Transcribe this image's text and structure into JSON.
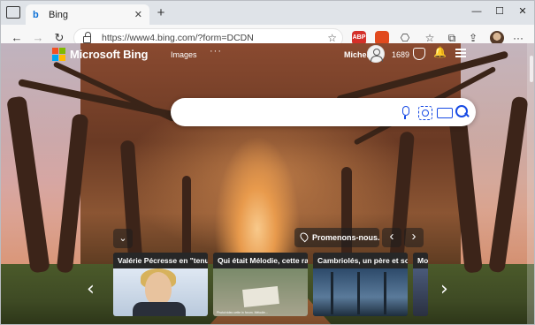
{
  "browser": {
    "tab_title": "Bing",
    "tab_favicon": "b",
    "new_tab": "+",
    "url": "https://www4.bing.com/?form=DCDN",
    "window_controls": {
      "minimize": "—",
      "maximize": "☐",
      "close": "✕"
    },
    "extensions": [
      "ABP",
      "office-icon",
      "copilot-icon",
      "favorites-icon",
      "collections-icon",
      "share-icon"
    ]
  },
  "bing": {
    "brand": "Microsoft Bing",
    "nav_images": "Images",
    "nav_more": "···",
    "user_name": "Michel",
    "points": "1689",
    "colors": {
      "red": "#f25022",
      "green": "#7fba00",
      "blue": "#00a4ef",
      "yellow": "#ffb900",
      "accent": "#174ae4"
    }
  },
  "controls": {
    "collapse": "⌄",
    "location_label": "Promenons-nous...",
    "prev": "‹",
    "next": "›"
  },
  "carousel": {
    "prev": "‹",
    "next": "›",
    "cards": [
      {
        "title": "Valérie Pécresse en \"tenue i..."
      },
      {
        "title": "Qui était Mélodie, cette ra...",
        "caption": "Photo/video cette in forum. Mélodie..."
      },
      {
        "title": "Cambriolés, un père et son..."
      },
      {
        "title": "Mo"
      }
    ]
  }
}
